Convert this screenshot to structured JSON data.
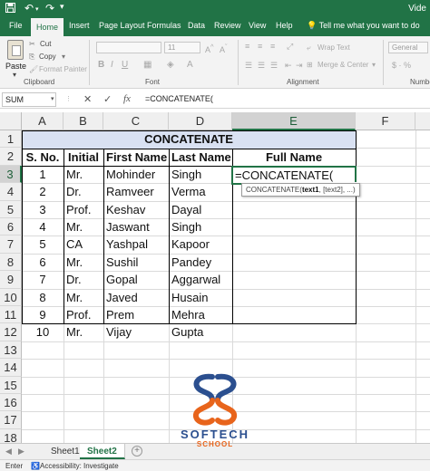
{
  "window": {
    "title": "Vide",
    "quick_access": [
      "save-icon",
      "undo-icon",
      "redo-icon",
      "customize-icon"
    ]
  },
  "ribbon_tabs": {
    "items": [
      "File",
      "Home",
      "Insert",
      "Page Layout",
      "Formulas",
      "Data",
      "Review",
      "View",
      "Help"
    ],
    "active": "Home",
    "tell_me": "Tell me what you want to do"
  },
  "ribbon": {
    "clipboard": {
      "paste": "Paste",
      "cut": "Cut",
      "copy": "Copy",
      "format_painter": "Format Painter",
      "label": "Clipboard"
    },
    "font": {
      "font_name": "",
      "font_size": "11",
      "bold": "B",
      "italic": "I",
      "underline": "U",
      "label": "Font"
    },
    "alignment": {
      "wrap_text": "Wrap Text",
      "merge_center": "Merge & Center",
      "label": "Alignment"
    },
    "number": {
      "format": "General",
      "label": "Numbe"
    }
  },
  "formula_bar": {
    "name_box": "SUM",
    "cancel": "✕",
    "enter": "✓",
    "fx": "fx",
    "formula": "=CONCATENATE("
  },
  "grid": {
    "columns": [
      "A",
      "B",
      "C",
      "D",
      "E",
      "F"
    ],
    "rows": [
      "1",
      "2",
      "3",
      "4",
      "5",
      "6",
      "7",
      "8",
      "9",
      "10",
      "11",
      "12",
      "13",
      "14",
      "15",
      "16",
      "17",
      "18"
    ],
    "selected_column": "E",
    "selected_row": "3"
  },
  "table": {
    "title": "CONCATENATE",
    "headers": [
      "S. No.",
      "Initial",
      "First Name",
      "Last Name",
      "Full Name"
    ],
    "rows": [
      [
        "1",
        "Mr.",
        "Mohinder",
        "Singh",
        "=CONCATENATE("
      ],
      [
        "2",
        "Dr.",
        "Ramveer",
        "Verma",
        ""
      ],
      [
        "3",
        "Prof.",
        "Keshav",
        "Dayal",
        ""
      ],
      [
        "4",
        "Mr.",
        "Jaswant",
        "Singh",
        ""
      ],
      [
        "5",
        "CA",
        "Yashpal",
        "Kapoor",
        ""
      ],
      [
        "6",
        "Mr.",
        "Sushil",
        "Pandey",
        ""
      ],
      [
        "7",
        "Dr.",
        "Gopal",
        "Aggarwal",
        ""
      ],
      [
        "8",
        "Mr.",
        "Javed",
        "Husain",
        ""
      ],
      [
        "9",
        "Prof.",
        "Prem",
        "Mehra",
        ""
      ],
      [
        "10",
        "Mr.",
        "Vijay",
        "Gupta",
        ""
      ]
    ]
  },
  "tooltip": {
    "fn": "CONCATENATE(",
    "arg1": "text1",
    "rest": ", [text2], ...)"
  },
  "logo": {
    "line1": "SOFTECH",
    "line2": "SCHOOL",
    "blue": "#2b4f8f",
    "orange": "#e8641b"
  },
  "sheets": {
    "tabs": [
      "Sheet1",
      "Sheet2"
    ],
    "active": "Sheet2"
  },
  "status_bar": {
    "mode": "Enter",
    "accessibility": "Accessibility: Investigate"
  },
  "colors": {
    "excel_green": "#217346",
    "title_band": "#d9e1f2"
  }
}
